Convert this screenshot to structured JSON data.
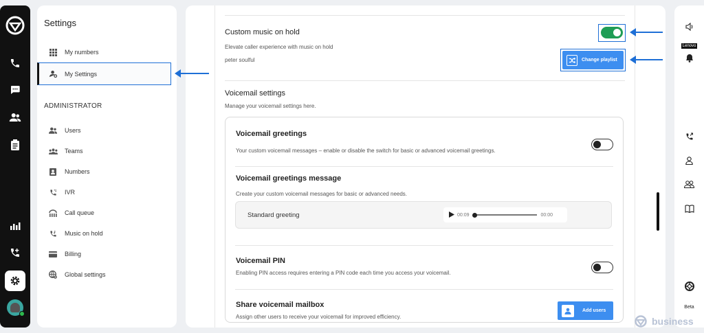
{
  "app": {
    "brand_colors": {
      "accent": "#1e6fd6",
      "toggle_on": "#1f9d55",
      "button": "#3d8ef0"
    }
  },
  "nav": {
    "title": "Settings",
    "items": [
      {
        "label": "My numbers",
        "icon": "grid-icon"
      },
      {
        "label": "My Settings",
        "icon": "user-settings-icon",
        "active": true
      }
    ],
    "admin_heading": "ADMINISTRATOR",
    "admin_items": [
      {
        "label": "Users",
        "icon": "users-icon"
      },
      {
        "label": "Teams",
        "icon": "teams-icon"
      },
      {
        "label": "Numbers",
        "icon": "contact-card-icon"
      },
      {
        "label": "IVR",
        "icon": "phone-menu-icon"
      },
      {
        "label": "Call queue",
        "icon": "queue-icon"
      },
      {
        "label": "Music on hold",
        "icon": "phone-music-icon"
      },
      {
        "label": "Billing",
        "icon": "credit-card-icon"
      },
      {
        "label": "Global settings",
        "icon": "globe-gear-icon"
      }
    ]
  },
  "music": {
    "title": "Custom music on hold",
    "description": "Elevate caller experience with music on hold",
    "playlist": "peter soulful",
    "enabled": true,
    "change_button": "Change playlist"
  },
  "voicemail": {
    "title": "Voicemail settings",
    "description": "Manage your voicemail settings here.",
    "greetings": {
      "title": "Voicemail greetings",
      "description": "Your custom voicemail messages – enable or disable the switch for basic or advanced voicemail greetings.",
      "enabled": false
    },
    "message": {
      "title": "Voicemail greetings message",
      "description": "Create your custom voicemail messages for basic or advanced needs.",
      "greeting_label": "Standard greeting",
      "time_current": "00:09",
      "time_total": "00:00"
    },
    "pin": {
      "title": "Voicemail PIN",
      "description": "Enabling PIN access requires entering a PIN code each time you access your voicemail.",
      "enabled": false
    },
    "share": {
      "title": "Share voicemail mailbox",
      "description": "Assign other users to receive your voicemail for improved efficiency.",
      "button": "Add users"
    }
  },
  "right": {
    "brand": "Lenovo",
    "beta": "Beta"
  },
  "watermark": "business"
}
